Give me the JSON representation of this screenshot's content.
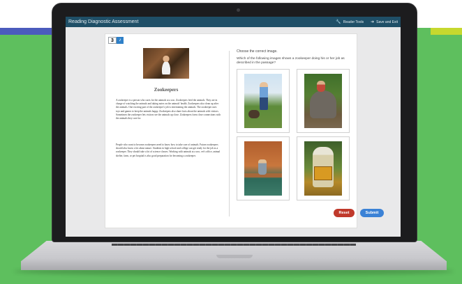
{
  "app": {
    "title": "Reading Diagnostic Assessment",
    "toolbar": [
      {
        "label": "Reader Tools",
        "icon": "wrench-icon"
      },
      {
        "label": "Save and Exit",
        "icon": "exit-icon"
      }
    ]
  },
  "question": {
    "number": "3",
    "audio_icon": "speaker-icon"
  },
  "passage": {
    "title": "Zookeepers",
    "paragraphs": [
      "A zookeeper is a person who cares for the animals at a zoo. Zookeepers feed the animals. They are in charge of watching the animals and taking notes on the animals' health. Zookeepers also clean up after the animals. One exciting part of the zookeeper's job is entertaining the animals. The zookeeper uses toys and games to keep the animals happy. Zookeepers also share facts about the animals with visitors. Sometimes the zookeeper lets visitors see the animals up close. Zookeepers form close connections with the animals they care for.",
      "People who want to become zookeepers need to know how to take care of animals. Future zookeepers should also know a lot about nature. Students in high school and college can get ready for the job as a zookeeper. They should take a lot of science classes. Working with animals at a zoo, vet's office, animal shelter, farm, or pet hospital is also good preparation for becoming a zookeeper."
    ]
  },
  "prompt": {
    "instruction": "Choose the correct image.",
    "question": "Which of the following images shows a zookeeper doing his or her job as described in the passage?"
  },
  "buttons": {
    "reset": "Reset",
    "submit": "Submit"
  },
  "colors": {
    "header": "#1f4f67",
    "reset": "#c0392b",
    "submit": "#3b82d6",
    "background_green": "#5ebf5e"
  }
}
